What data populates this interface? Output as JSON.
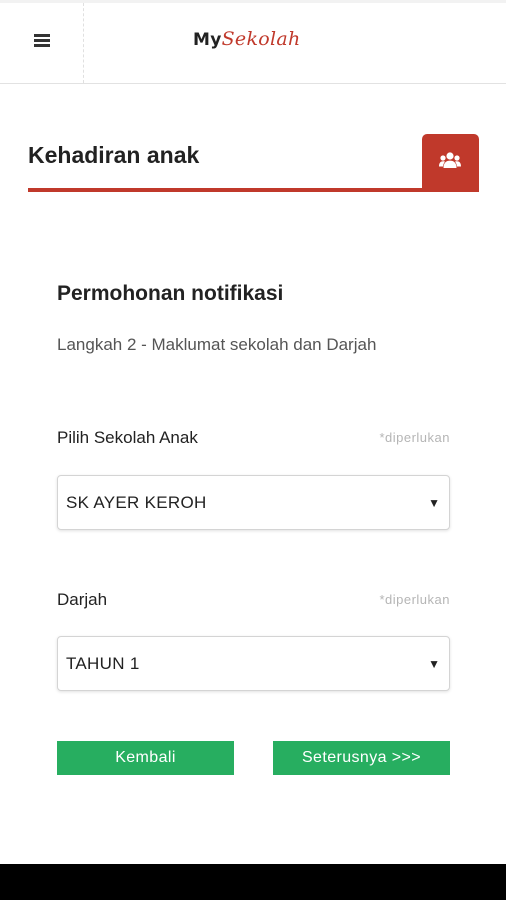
{
  "header": {
    "logo_my": "My",
    "logo_sekolah": "Sekolah"
  },
  "section": {
    "title": "Kehadiran anak",
    "icon": "users-icon",
    "accent_color": "#c0392b"
  },
  "form": {
    "title": "Permohonan notifikasi",
    "step": "Langkah 2 - Maklumat sekolah dan Darjah",
    "school": {
      "label": "Pilih Sekolah Anak",
      "required": "*diperlukan",
      "value": "SK AYER KEROH"
    },
    "darjah": {
      "label": "Darjah",
      "required": "*diperlukan",
      "value": "TAHUN 1"
    }
  },
  "buttons": {
    "back": "Kembali",
    "next": "Seterusnya >>>",
    "color": "#27ae60"
  }
}
